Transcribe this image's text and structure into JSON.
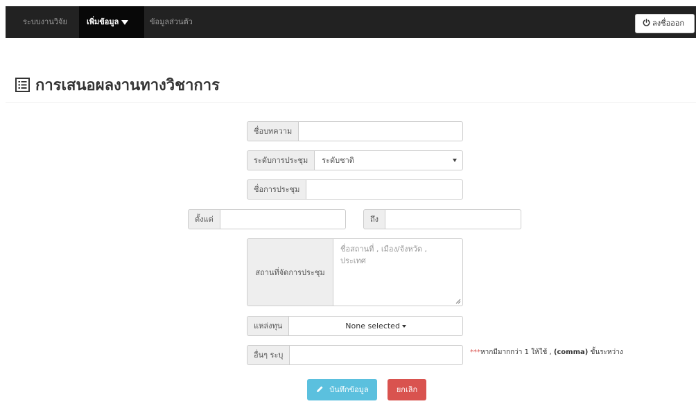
{
  "navbar": {
    "items": [
      {
        "label": "ระบบงานวิจัย",
        "active": false
      },
      {
        "label": "เพิ่มข้อมูล",
        "active": true
      },
      {
        "label": "ข้อมูลส่วนตัว",
        "active": false
      }
    ],
    "logout_label": "ลงชื่อออก",
    "icons": {
      "logout": "power-icon",
      "dropdown": "caret-down-icon"
    }
  },
  "page": {
    "title": "การเสนอผลงานทางวิชาการ",
    "title_icon": "list-icon"
  },
  "form": {
    "article_name": {
      "label": "ชื่อบทความ",
      "value": ""
    },
    "conference_level": {
      "label": "ระดับการประชุม",
      "selected": "ระดับชาติ"
    },
    "conference_name": {
      "label": "ชื่อการประชุม",
      "value": ""
    },
    "date_from": {
      "label": "ตั้งแต่",
      "value": ""
    },
    "date_to": {
      "label": "ถึง",
      "value": ""
    },
    "venue": {
      "label": "สถานที่จัดการประชุม",
      "placeholder_line1": "ชื่อสถานที่ , เมือง/จังหวัด ,",
      "placeholder_line2": "ประเทศ"
    },
    "funding": {
      "label": "แหล่งทุน",
      "selected": "None selected"
    },
    "other": {
      "label": "อื่นๆ ระบุ",
      "value": ""
    },
    "note": {
      "stars": "***",
      "text": "หากมีมากกว่า 1 ให้ใช้ , ",
      "bold": "(comma)",
      "text_end": " ขั้นระหว่าง"
    }
  },
  "buttons": {
    "save_label": "บันทึกข้อมูล",
    "cancel_label": "ยกเลิก"
  },
  "colors": {
    "navbar_bg": "#222222",
    "save": "#5bc0de",
    "cancel": "#d9534f"
  }
}
